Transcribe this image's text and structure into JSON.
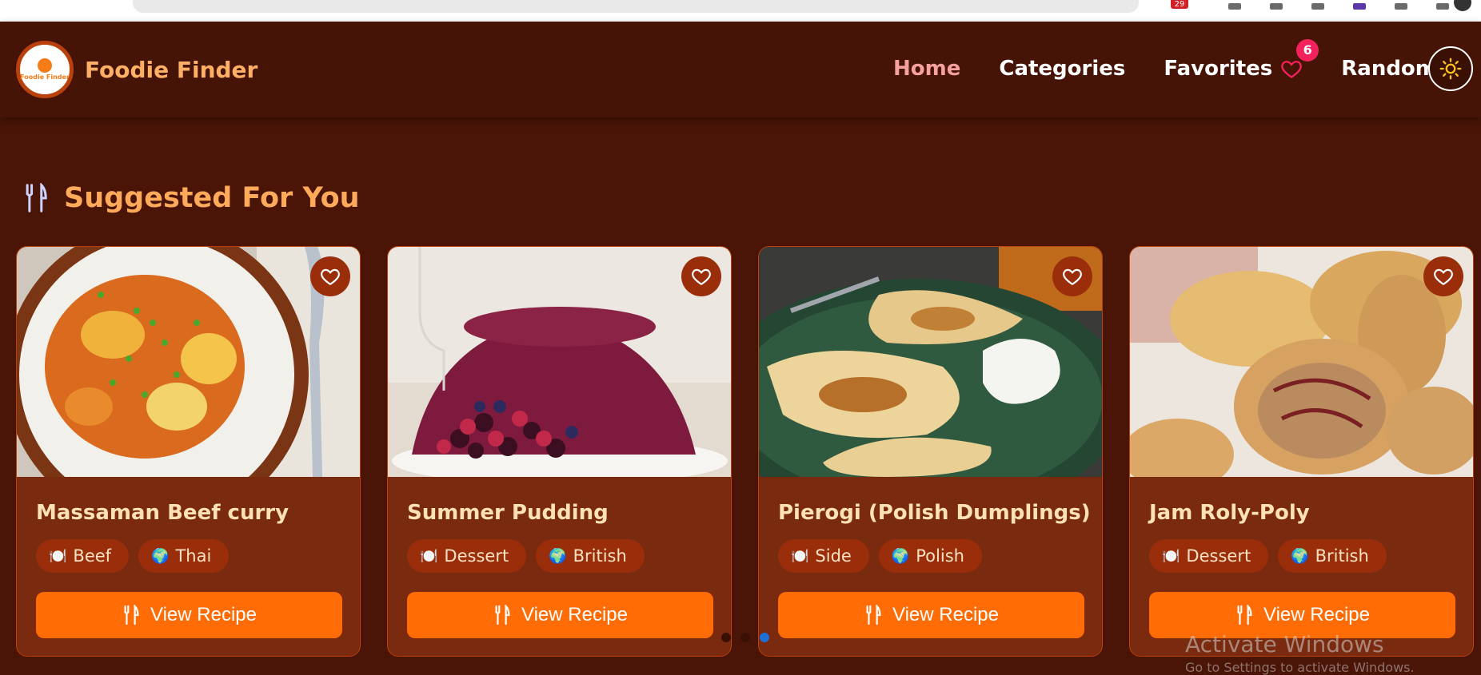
{
  "browser": {
    "extension_badge": "29"
  },
  "brand": {
    "logo_text": "Foodie Finder",
    "name": "Foodie Finder"
  },
  "nav": {
    "home": "Home",
    "categories": "Categories",
    "favorites": "Favorites",
    "favorites_count": "6",
    "random": "Random"
  },
  "section": {
    "title": "Suggested For You"
  },
  "cards": [
    {
      "title": "Massaman Beef curry",
      "category": "Beef",
      "area": "Thai",
      "button": "View Recipe"
    },
    {
      "title": "Summer Pudding",
      "category": "Dessert",
      "area": "British",
      "button": "View Recipe"
    },
    {
      "title": "Pierogi (Polish Dumplings)",
      "category": "Side",
      "area": "Polish",
      "button": "View Recipe"
    },
    {
      "title": "Jam Roly-Poly",
      "category": "Dessert",
      "area": "British",
      "button": "View Recipe"
    }
  ],
  "carousel": {
    "active_index": 2,
    "total": 3
  },
  "watermark": {
    "title": "Activate Windows",
    "subtitle": "Go to Settings to activate Windows."
  },
  "colors": {
    "accent": "#ff6b04",
    "background": "#4a1507",
    "card": "#7a2a0e",
    "active_nav": "#f6a0a0",
    "badge": "#f4225c"
  }
}
